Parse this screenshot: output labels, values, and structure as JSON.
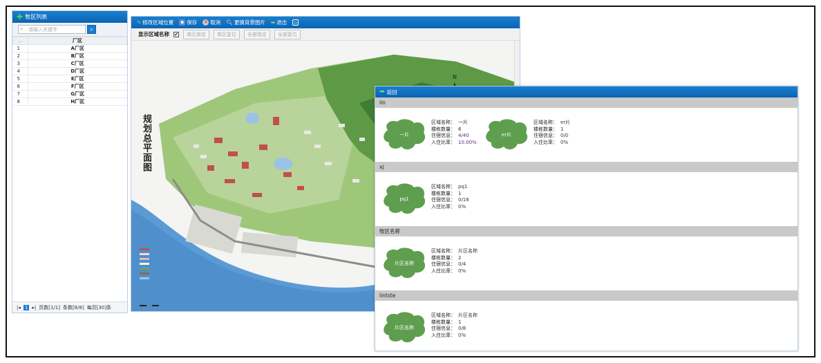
{
  "left_panel": {
    "title": "牧区列表",
    "search_placeholder": "请输入关键字",
    "table": {
      "col_index": "...",
      "col_name": "厂区",
      "rows": [
        {
          "index": "1",
          "name": "A厂区"
        },
        {
          "index": "2",
          "name": "B厂区"
        },
        {
          "index": "3",
          "name": "C厂区"
        },
        {
          "index": "4",
          "name": "D厂区"
        },
        {
          "index": "5",
          "name": "E厂区"
        },
        {
          "index": "6",
          "name": "F厂区"
        },
        {
          "index": "7",
          "name": "G厂区"
        },
        {
          "index": "8",
          "name": "H厂区"
        }
      ]
    },
    "pager": {
      "current_page": "1",
      "page_info": "页数[1/1]",
      "record_info": "条数[8/8]",
      "per_page": "每页[30]条"
    }
  },
  "map_panel": {
    "toolbar": {
      "edit_location": "修改区域位置",
      "save": "保存",
      "cancel": "取消",
      "change_bg": "更换背景图片",
      "exit": "退出"
    },
    "subbar": {
      "show_name_label": "显示区域名称",
      "show_name_checked": "✔",
      "btn_lock_single": "单区锁定",
      "btn_reset_single": "单区复位",
      "btn_lock_all": "全部锁定",
      "btn_reset_all": "全部复位"
    },
    "map_title": "规划总平面图",
    "north_label": "N"
  },
  "popup": {
    "back_label": "返回",
    "labels": {
      "area_name": "区域名称：",
      "building_count": "楼栋数量：",
      "residence_info": "住宿信息：",
      "occupancy": "入住比率："
    },
    "sections": [
      {
        "header": "lin",
        "cards": [
          {
            "blob_label": "一片",
            "name": "一片",
            "buildings": "6",
            "residence": "4/40",
            "occupancy": "10.00%"
          },
          {
            "blob_label": "er片",
            "name": "er片",
            "buildings": "1",
            "residence": "0/0",
            "occupancy": "0%"
          }
        ]
      },
      {
        "header": "xj",
        "cards": [
          {
            "blob_label": "pq1",
            "name": "pq1",
            "buildings": "1",
            "residence": "0/16",
            "occupancy": "0%"
          }
        ]
      },
      {
        "header": "牧区名称",
        "cards": [
          {
            "blob_label": "片区名称",
            "name": "片区名称",
            "buildings": "2",
            "residence": "0/4",
            "occupancy": "0%"
          }
        ]
      },
      {
        "header": "lintste",
        "cards": [
          {
            "blob_label": "片区名称",
            "name": "片区名称",
            "buildings": "1",
            "residence": "0/8",
            "occupancy": "0%"
          }
        ]
      }
    ]
  },
  "colors": {
    "header_blue": "#0b64b3",
    "blob_green": "#5f9e4e",
    "section_gray": "#c9c9c9"
  }
}
